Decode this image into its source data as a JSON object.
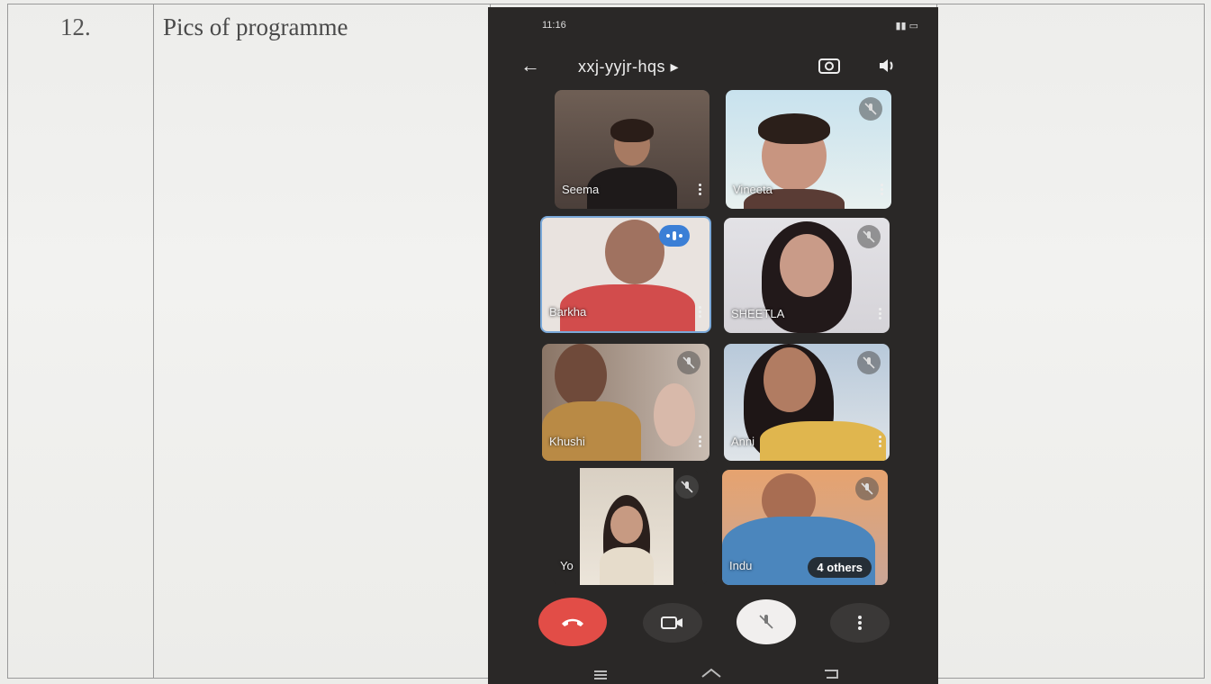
{
  "row": {
    "number": "12.",
    "label": "Pics of programme"
  },
  "phone": {
    "status_time": "11:16",
    "meeting_code": "xxj-yyjr-hqs",
    "participants": [
      {
        "name": "Seema",
        "muted": false
      },
      {
        "name": "Vineeta",
        "muted": true
      },
      {
        "name": "Barkha",
        "muted": false,
        "speaking": true
      },
      {
        "name": "SHEETLA",
        "muted": true
      },
      {
        "name": "Khushi",
        "muted": true
      },
      {
        "name": "Anni",
        "muted": true
      },
      {
        "name": "Yo",
        "muted": true
      },
      {
        "name": "Indu",
        "muted": true
      }
    ],
    "others_label": "4 others"
  },
  "colors": {
    "end_call": "#e24d47",
    "speaking": "#3b7fd6",
    "phone_bg": "#2a2827"
  }
}
